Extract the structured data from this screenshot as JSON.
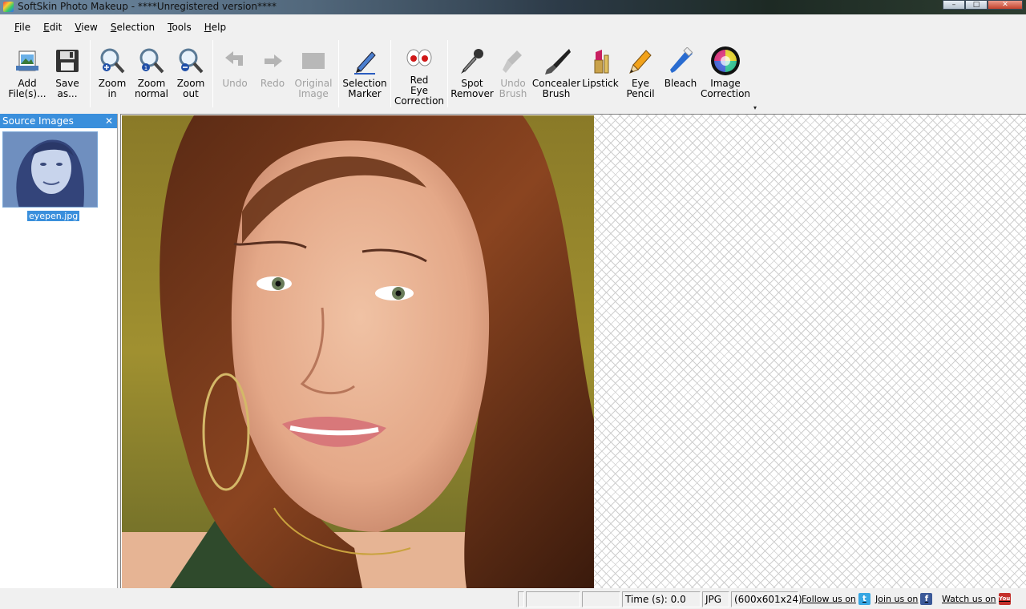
{
  "window": {
    "title": "SoftSkin Photo Makeup - ****Unregistered version****",
    "minimize": "–",
    "maximize": "□",
    "close": "✕"
  },
  "menu": [
    "File",
    "Edit",
    "View",
    "Selection",
    "Tools",
    "Help"
  ],
  "toolbar": {
    "add_files": "Add\nFile(s)...",
    "save_as": "Save\nas...",
    "zoom_in": "Zoom\nin",
    "zoom_normal": "Zoom\nnormal",
    "zoom_out": "Zoom\nout",
    "undo": "Undo",
    "redo": "Redo",
    "original_image": "Original\nImage",
    "selection_marker": "Selection\nMarker",
    "red_eye": "Red\nEye\nCorrection",
    "spot_remover": "Spot\nRemover",
    "undo_brush": "Undo\nBrush",
    "concealer_brush": "Concealer\nBrush",
    "lipstick": "Lipstick",
    "eye_pencil": "Eye\nPencil",
    "bleach": "Bleach",
    "image_correction": "Image\nCorrection",
    "more": "▾"
  },
  "source_panel": {
    "title": "Source Images",
    "close": "✕",
    "files": [
      "eyepen.jpg"
    ]
  },
  "status": {
    "time": "Time (s): 0.0",
    "format": "JPG",
    "dimensions": "(600x601x24)",
    "follow": "Follow us on",
    "join": "Join us on",
    "watch": "Watch us on",
    "tw": "t",
    "fb": "f",
    "yt": "You"
  },
  "colors": {
    "accent": "#3a8fdc",
    "checker_line": "#cfcfcf"
  }
}
